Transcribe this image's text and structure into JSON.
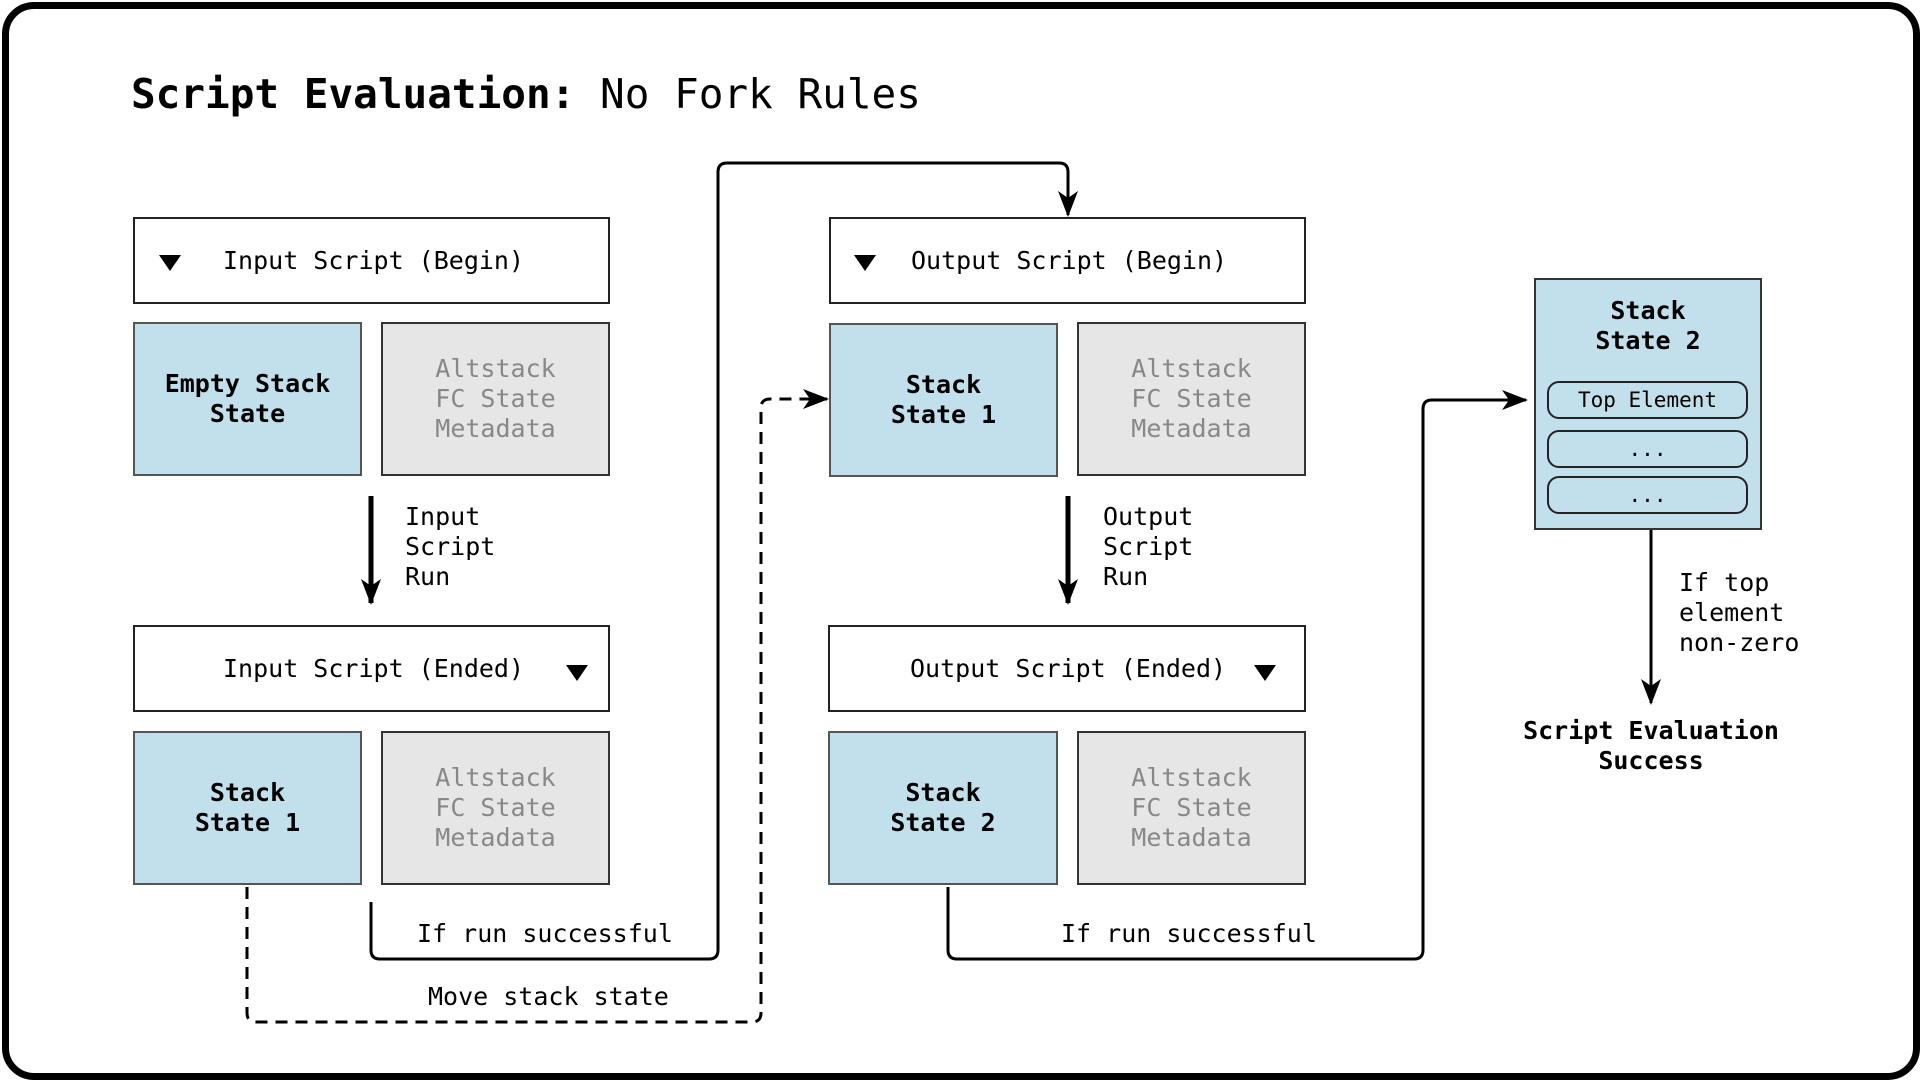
{
  "title": {
    "bold": "Script Evaluation:",
    "regular": " No Fork Rules"
  },
  "input": {
    "begin_label": "Input Script (Begin)",
    "initial_stack": "Empty Stack\nState",
    "altstack": "Altstack\nFC State\nMetadata",
    "run_label": "Input\nScript\nRun",
    "ended_label": "Input Script (Ended)",
    "final_stack": "Stack\nState 1",
    "final_altstack": "Altstack\nFC State\nMetadata"
  },
  "output": {
    "begin_label": "Output Script (Begin)",
    "initial_stack": "Stack\nState 1",
    "altstack": "Altstack\nFC State\nMetadata",
    "run_label": "Output\nScript\nRun",
    "ended_label": "Output Script (Ended)",
    "final_stack": "Stack\nState 2",
    "final_altstack": "Altstack\nFC State\nMetadata"
  },
  "connectors": {
    "input_success": "If run successful",
    "move_state": "Move stack state",
    "output_success": "If run successful"
  },
  "result_stack": {
    "title": "Stack\nState 2",
    "elements": [
      "Top Element",
      "...",
      "..."
    ],
    "condition": "If top\nelement\nnon-zero",
    "outcome": "Script Evaluation\nSuccess"
  },
  "colors": {
    "stack_fill": "#c2e0ec",
    "altstack_fill": "#e6e6e6",
    "altstack_text": "#888888"
  }
}
